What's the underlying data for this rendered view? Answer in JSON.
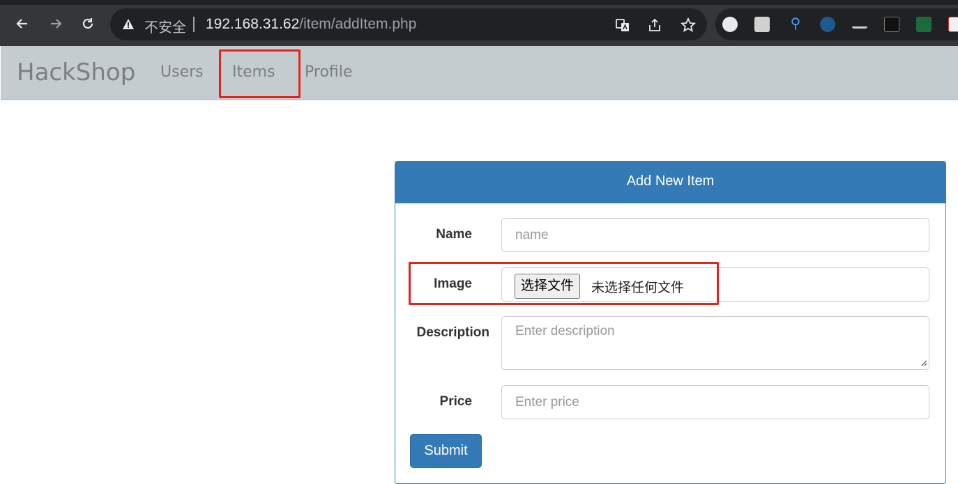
{
  "browser": {
    "security_label": "不安全",
    "url_host": "192.168.31.62",
    "url_path": "/item/addItem.php"
  },
  "navbar": {
    "brand": "HackShop",
    "links": [
      "Users",
      "Items",
      "Profile"
    ]
  },
  "form": {
    "title": "Add New Item",
    "name_label": "Name",
    "name_placeholder": "name",
    "image_label": "Image",
    "file_button": "选择文件",
    "file_status": "未选择任何文件",
    "description_label": "Description",
    "description_placeholder": "Enter description",
    "price_label": "Price",
    "price_placeholder": "Enter price",
    "submit": "Submit"
  },
  "colors": {
    "primary": "#337ab7",
    "navbar_bg": "#c4cccf",
    "highlight": "#e5221e",
    "chrome_bg": "#35363a"
  }
}
